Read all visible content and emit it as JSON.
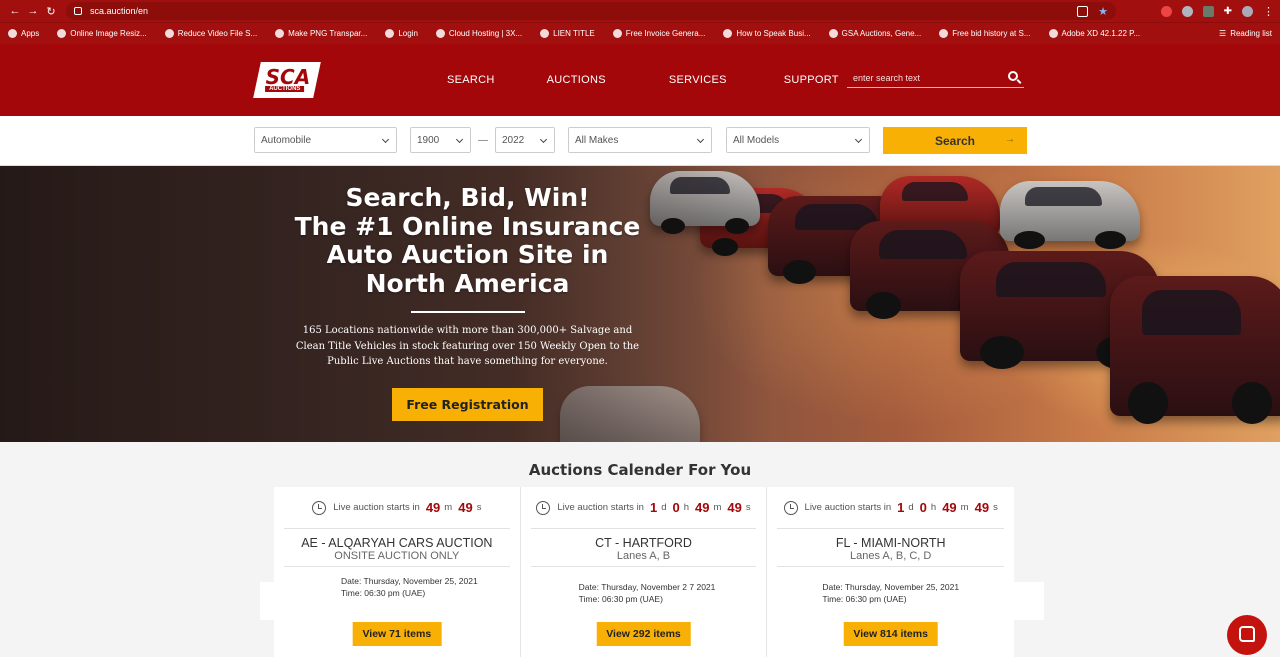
{
  "browser": {
    "url": "sca.auction/en",
    "bookmarks": [
      {
        "label": "Apps"
      },
      {
        "label": "Online Image Resiz..."
      },
      {
        "label": "Reduce Video File S..."
      },
      {
        "label": "Make PNG Transpar..."
      },
      {
        "label": "Login"
      },
      {
        "label": "Cloud Hosting | 3X..."
      },
      {
        "label": "LIEN TITLE"
      },
      {
        "label": "Free Invoice Genera..."
      },
      {
        "label": "How to Speak Busi..."
      },
      {
        "label": "GSA Auctions, Gene..."
      },
      {
        "label": "Free bid history at S..."
      },
      {
        "label": "Adobe XD 42.1.22 P..."
      }
    ],
    "reading_list": "Reading list"
  },
  "header": {
    "logo_main": "SCA",
    "logo_sub": "AUCTIONS",
    "nav": [
      "SEARCH",
      "AUCTIONS",
      "SERVICES",
      "SUPPORT"
    ],
    "search_placeholder": "enter search text"
  },
  "filters": {
    "category": "Automobile",
    "year_from": "1900",
    "year_to": "2022",
    "makes": "All Makes",
    "models": "All Models",
    "search_label": "Search",
    "search_arrow": "→"
  },
  "hero": {
    "title": "Search, Bid, Win!\nThe #1 Online Insurance\nAuto Auction Site in\nNorth America",
    "description": "165 Locations nationwide with more than 300,000+ Salvage and Clean Title Vehicles in stock featuring over 150 Weekly Open to the Public Live Auctions that have something for everyone.",
    "cta": "Free Registration"
  },
  "calendar": {
    "title": "Auctions Calender For You",
    "cards": [
      {
        "prefix": "Live auction starts in",
        "parts": [
          {
            "v": "49",
            "u": "m"
          },
          {
            "v": "49",
            "u": "s"
          }
        ],
        "name": "AE - ALQARYAH CARS AUCTION",
        "sub": "ONSITE AUCTION ONLY",
        "date": "Date: Thursday, November 25, 2021",
        "time": "Time: 06:30 pm (UAE)",
        "button": "View 71 items"
      },
      {
        "prefix": "Live auction starts in",
        "parts": [
          {
            "v": "1",
            "u": "d"
          },
          {
            "v": "0",
            "u": "h"
          },
          {
            "v": "49",
            "u": "m"
          },
          {
            "v": "49",
            "u": "s"
          }
        ],
        "name": "CT - HARTFORD",
        "sub": "Lanes A, B",
        "date": "Date: Thursday, November 2 7 2021",
        "time": "Time: 06:30 pm (UAE)",
        "button": "View 292 items"
      },
      {
        "prefix": "Live auction starts in",
        "parts": [
          {
            "v": "1",
            "u": "d"
          },
          {
            "v": "0",
            "u": "h"
          },
          {
            "v": "49",
            "u": "m"
          },
          {
            "v": "49",
            "u": "s"
          }
        ],
        "name": "FL - MIAMI-NORTH",
        "sub": "Lanes A, B, C, D",
        "date": "Date: Thursday, November 25, 2021",
        "time": "Time: 06:30 pm (UAE)",
        "button": "View 814 items"
      }
    ]
  }
}
